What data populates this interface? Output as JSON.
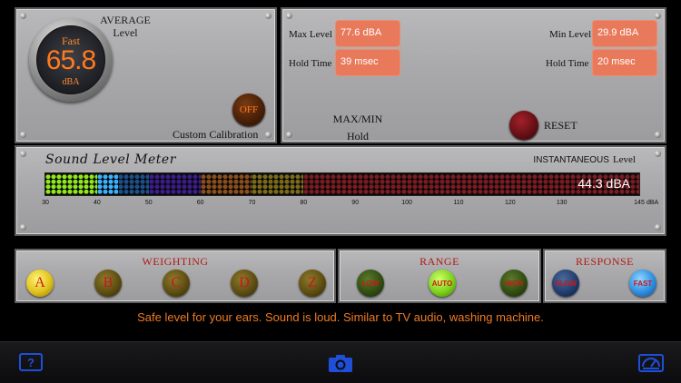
{
  "average": {
    "speed": "Fast",
    "value": "65.8",
    "unit": "dBA",
    "title": "AVERAGE",
    "subtitle": "Level",
    "calibration_state": "OFF",
    "calibration_label": "Custom Calibration"
  },
  "minmax": {
    "max_label": "Max Level",
    "max_value": "77.6 dBA",
    "max_hold_label": "Hold Time",
    "max_hold_value": "39 msec",
    "min_label": "Min Level",
    "min_value": "29.9 dBA",
    "min_hold_label": "Hold Time",
    "min_hold_value": "20 msec",
    "hold_title": "MAX/MIN",
    "hold_subtitle": "Hold",
    "reset_label": "RESET"
  },
  "meter": {
    "title": "Sound Level Meter",
    "mode": "INSTANTANEOUS",
    "mode_suffix": "Level",
    "reading": "44.3 dBA",
    "reading_db": 44.3,
    "scale_min": 30,
    "scale_max": 145,
    "ticks": [
      "30",
      "40",
      "50",
      "60",
      "70",
      "80",
      "90",
      "100",
      "110",
      "120",
      "130",
      "145"
    ],
    "tick_values": [
      30,
      40,
      50,
      60,
      70,
      80,
      90,
      100,
      110,
      120,
      130,
      145
    ],
    "unit": "dBA",
    "bands": [
      {
        "from": 30,
        "to": 40,
        "color": "#8fe81c"
      },
      {
        "from": 40,
        "to": 44,
        "color": "#3ab2ff"
      },
      {
        "from": 44,
        "to": 50,
        "color": "#1c4f8a"
      },
      {
        "from": 50,
        "to": 60,
        "color": "#3a1c8a"
      },
      {
        "from": 60,
        "to": 70,
        "color": "#8a4e1c"
      },
      {
        "from": 70,
        "to": 80,
        "color": "#7a6a1a"
      },
      {
        "from": 80,
        "to": 145,
        "color": "#7a1c22"
      }
    ]
  },
  "weighting": {
    "title": "WEIGHTING",
    "options": [
      "A",
      "B",
      "C",
      "D",
      "Z"
    ],
    "selected": "A"
  },
  "range": {
    "title": "RANGE",
    "options": [
      "LOW",
      "AUTO",
      "HIGH"
    ],
    "selected": "AUTO"
  },
  "response": {
    "title": "RESPONSE",
    "options": [
      "SLOW",
      "FAST"
    ],
    "selected": "FAST"
  },
  "message": "Safe level for your ears. Sound is loud. Similar to TV audio, washing machine.",
  "toolbar": {
    "help_icon": "question-icon",
    "camera_icon": "camera-icon",
    "meter_icon": "gauge-icon",
    "accent_color": "#1f4fd8"
  }
}
